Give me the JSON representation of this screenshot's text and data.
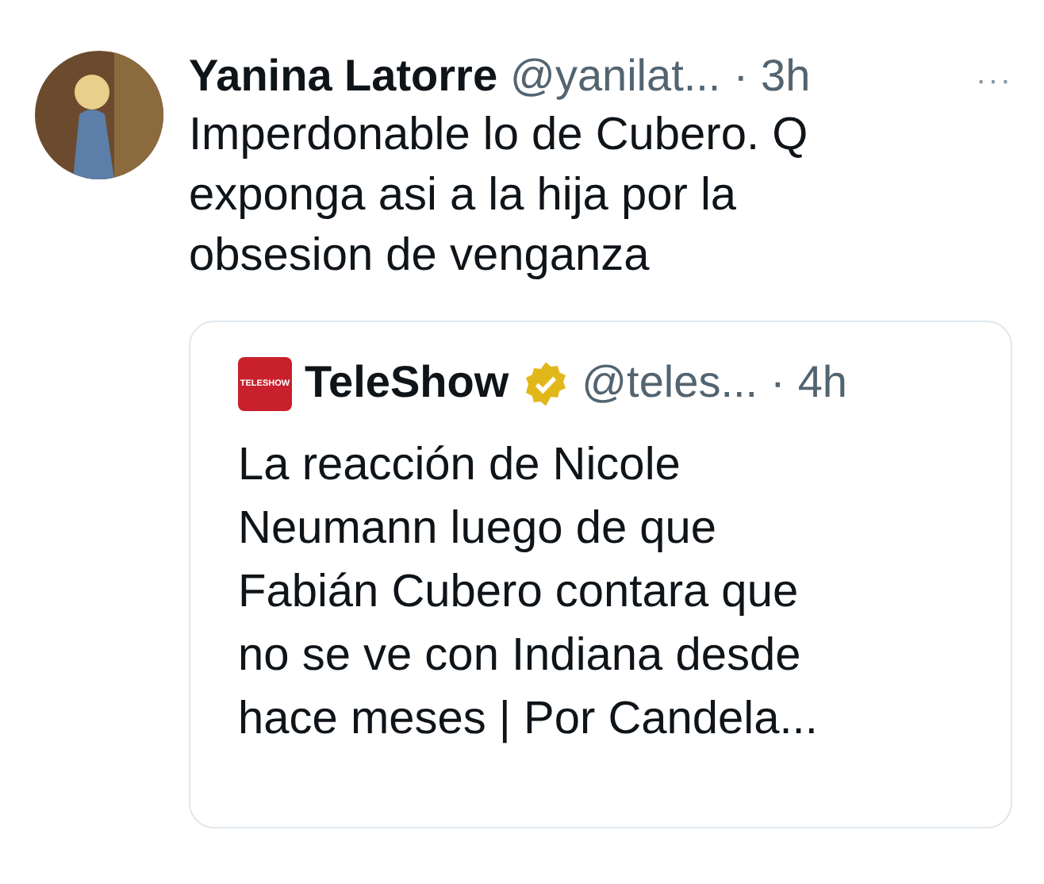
{
  "tweet": {
    "name": "Yanina Latorre",
    "handle": "@yanilat...",
    "separator": "·",
    "time": "3h",
    "more": "···",
    "text": "Imperdonable lo de Cubero. Q\nexponga asi a la hija por la\nobsesion de venganza",
    "quote": {
      "logo": "TELESHOW",
      "name": "TeleShow",
      "verified": true,
      "handle": "@teles...",
      "separator": "·",
      "time": "4h",
      "text": "La reacción de Nicole\nNeumann luego de que\nFabián Cubero contara que\nno se ve con Indiana desde\nhace meses | Por Candela..."
    }
  }
}
